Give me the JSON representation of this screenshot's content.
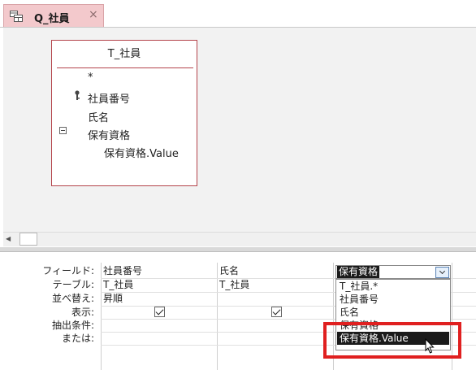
{
  "tab": {
    "title": "Q_社員",
    "close_glyph": "×",
    "icon": "query-icon"
  },
  "field_list": {
    "title": "T_社員",
    "items": [
      "*",
      "社員番号",
      "氏名",
      "保有資格",
      "保有資格.Value"
    ]
  },
  "grid": {
    "row_labels": [
      "フィールド:",
      "テーブル:",
      "並べ替え:",
      "表示:",
      "抽出条件:",
      "または:"
    ],
    "columns": [
      {
        "field": "社員番号",
        "table": "T_社員",
        "sort": "昇順",
        "show": true
      },
      {
        "field": "氏名",
        "table": "T_社員",
        "sort": "",
        "show": true
      },
      {
        "field": "保有資格",
        "table": "",
        "sort": "",
        "show": false
      }
    ]
  },
  "dropdown": {
    "options": [
      "T_社員.*",
      "社員番号",
      "氏名",
      "保有資格",
      "保有資格.Value"
    ],
    "selected": "保有資格.Value"
  },
  "colors": {
    "tab_bg": "#f3c9cc",
    "field_list_border": "#b4444b",
    "highlight": "#e02020"
  }
}
